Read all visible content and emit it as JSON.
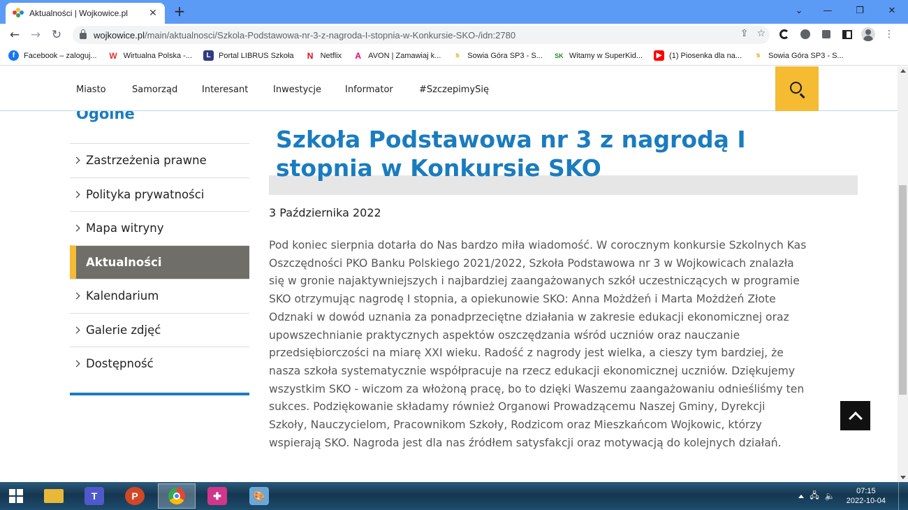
{
  "browser": {
    "tab_title": "Aktualności | Wojkowice.pl",
    "tab_close": "✕",
    "new_tab": "+",
    "url_host": "wojkowice.pl",
    "url_path": "/main/aktualnosci/Szkola-Podstawowa-nr-3-z-nagroda-I-stopnia-w-Konkursie-SKO-/idn:2780",
    "window_controls": {
      "dropdown": "⌄",
      "minimize": "—",
      "restore": "❐",
      "close": "✕"
    },
    "nav": {
      "back": "←",
      "forward": "→",
      "reload": "↻",
      "share": "⇪",
      "star": "☆",
      "menu": "⋮"
    }
  },
  "bookmarks": [
    {
      "label": "Facebook – zaloguj...",
      "icon": "facebook-icon",
      "color": "#1877f2",
      "glyph": "f"
    },
    {
      "label": "Wirtualna Polska -...",
      "icon": "wp-icon",
      "color": "#e5322d",
      "glyph": "W"
    },
    {
      "label": "Portal LIBRUS Szkoła",
      "icon": "librus-icon",
      "color": "#2f3c7e",
      "glyph": "L"
    },
    {
      "label": "Netflix",
      "icon": "netflix-icon",
      "color": "#e50914",
      "glyph": "N"
    },
    {
      "label": "AVON | Zamawiaj k...",
      "icon": "avon-icon",
      "color": "#e2007a",
      "glyph": "A"
    },
    {
      "label": "Sowia Góra SP3 - S...",
      "icon": "sko-icon",
      "color": "#f0a000",
      "glyph": "s"
    },
    {
      "label": "Witamy w SuperKid...",
      "icon": "superkid-icon",
      "color": "#2a8a2a",
      "glyph": "SK"
    },
    {
      "label": "(1) Piosenka dla na...",
      "icon": "youtube-icon",
      "color": "#ff0000",
      "glyph": "▶"
    },
    {
      "label": "Sowia Góra SP3 - S...",
      "icon": "sko-icon",
      "color": "#f0a000",
      "glyph": "s"
    }
  ],
  "site_nav": {
    "items": [
      "Miasto",
      "Samorząd",
      "Interesant",
      "Inwestycje",
      "Informator",
      "#SzczepimySię"
    ],
    "accent": "#f4bb33"
  },
  "sidebar": {
    "heading": "Ogólne",
    "items": [
      {
        "label": "Zastrzeżenia prawne",
        "active": false
      },
      {
        "label": "Polityka prywatności",
        "active": false
      },
      {
        "label": "Mapa witryny",
        "active": false
      },
      {
        "label": "Aktualności",
        "active": true
      },
      {
        "label": "Kalendarium",
        "active": false
      },
      {
        "label": "Galerie zdjęć",
        "active": false
      },
      {
        "label": "Dostępność",
        "active": false
      }
    ]
  },
  "article": {
    "title": "Szkoła Podstawowa nr 3 z nagrodą I stopnia w Konkursie SKO",
    "date": "3 Października 2022",
    "body": "Pod koniec sierpnia dotarła do Nas bardzo miła wiadomość. W corocznym konkursie Szkolnych Kas Oszczędności PKO Banku Polskiego 2021/2022, Szkoła Podstawowa nr 3 w Wojkowicach znalazła się w gronie najaktywniejszych i najbardziej zaangażowanych szkół uczestniczących w programie SKO otrzymując nagrodę I stopnia, a opiekunowie SKO: Anna Możdżeń i Marta Możdżeń Złote Odznaki w dowód uznania za ponadprzeciętne działania w zakresie edukacji ekonomicznej oraz upowszechnianie praktycznych aspektów oszczędzania wśród uczniów oraz nauczanie przedsiębiorczości na miarę XXI wieku. Radość z nagrody jest wielka, a cieszy tym bardziej, że nasza szkoła systematycznie współpracuje na rzecz edukacji ekonomicznej uczniów. Dziękujemy wszystkim SKO - wiczom za włożoną pracę, bo to dzięki Waszemu zaangażowaniu odnieśliśmy ten sukces. Podziękowanie składamy również Organowi Prowadzącemu Naszej Gminy, Dyrekcji Szkoły, Nauczycielom, Pracownikom Szkoły, Rodzicom oraz Mieszkańcom Wojkowic, którzy wspierają SKO.  Nagroda jest dla nas źródłem satysfakcji oraz motywacją do kolejnych działań."
  },
  "taskbar": {
    "apps": [
      {
        "name": "file-explorer",
        "icon": "folder-icon",
        "color": "#e8b838",
        "glyph": "",
        "active": false
      },
      {
        "name": "teams",
        "icon": "teams-icon",
        "color": "#5059c9",
        "glyph": "T",
        "active": false
      },
      {
        "name": "powerpoint",
        "icon": "powerpoint-icon",
        "color": "#d24726",
        "glyph": "P",
        "active": false
      },
      {
        "name": "chrome",
        "icon": "chrome-icon",
        "color": "#4285f4",
        "glyph": "",
        "active": true
      },
      {
        "name": "app-plus",
        "icon": "plus-app-icon",
        "color": "#d0368a",
        "glyph": "✚",
        "active": false
      },
      {
        "name": "paint",
        "icon": "paint-icon",
        "color": "#6aa8d8",
        "glyph": "🎨",
        "active": false
      }
    ],
    "time": "07:15",
    "date": "2022-10-04"
  }
}
